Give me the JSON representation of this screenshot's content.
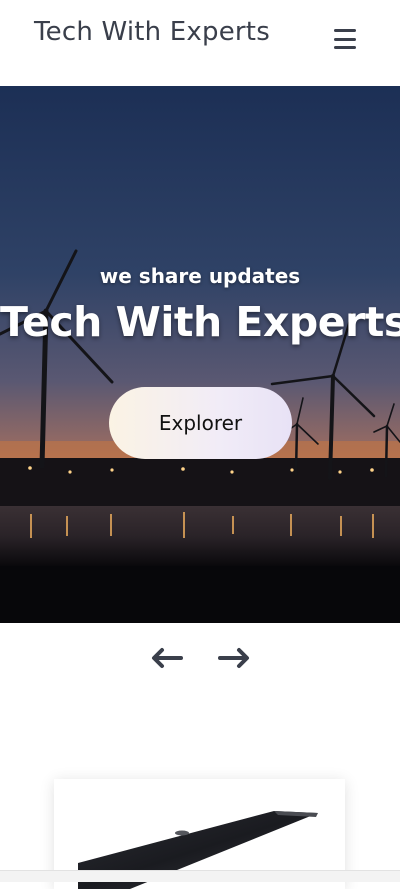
{
  "header": {
    "brand": "Tech With Experts",
    "menu_icon": "hamburger-icon"
  },
  "hero": {
    "subtitle": "we share updates",
    "title": "Tech With Experts",
    "button_label": "Explorer",
    "image": "wind-turbines-at-sunset"
  },
  "slider": {
    "prev_icon": "arrow-left-icon",
    "next_icon": "arrow-right-icon"
  },
  "products": [
    {
      "image": "laptop-image"
    }
  ],
  "colors": {
    "text_dark": "#3a3f4b",
    "button_gradient_start": "#fbf3e4",
    "button_gradient_end": "#e8e2f6",
    "sky_top": "#1c2f55",
    "horizon": "#d4834c"
  }
}
